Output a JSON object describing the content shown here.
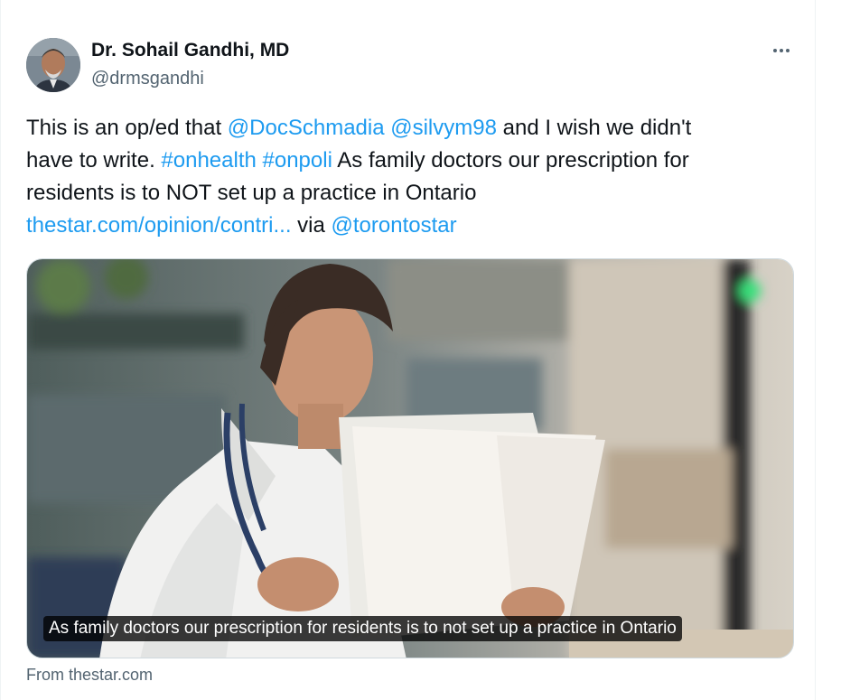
{
  "author": {
    "display_name": "Dr. Sohail Gandhi, MD",
    "handle": "@drmsgandhi"
  },
  "tweet": {
    "line1": [
      {
        "text": "This is an op/ed that ",
        "link": false
      },
      {
        "text": "@DocSchmadia",
        "link": true
      },
      {
        "text": " ",
        "link": false
      },
      {
        "text": "@silvym98",
        "link": true
      },
      {
        "text": " and I wish we didn't",
        "link": false
      }
    ],
    "line2": [
      {
        "text": "have to write. ",
        "link": false
      },
      {
        "text": "#onhealth",
        "link": true
      },
      {
        "text": " ",
        "link": false
      },
      {
        "text": "#onpoli",
        "link": true
      },
      {
        "text": " As family doctors our prescription for",
        "link": false
      }
    ],
    "line3": [
      {
        "text": "residents is to NOT set up a practice in Ontario",
        "link": false
      }
    ],
    "line4": [
      {
        "text": "thestar.com/opinion/contri...",
        "link": true
      },
      {
        "text": " via ",
        "link": false
      },
      {
        "text": "@torontostar",
        "link": true
      }
    ]
  },
  "card": {
    "caption": "As family doctors our prescription for residents is to not set up a practice in Ontario",
    "source": "From thestar.com"
  },
  "icons": {
    "more": "more-horizontal-icon"
  },
  "colors": {
    "link": "#1d9bf0",
    "text": "#0f1419",
    "secondary": "#536471"
  }
}
